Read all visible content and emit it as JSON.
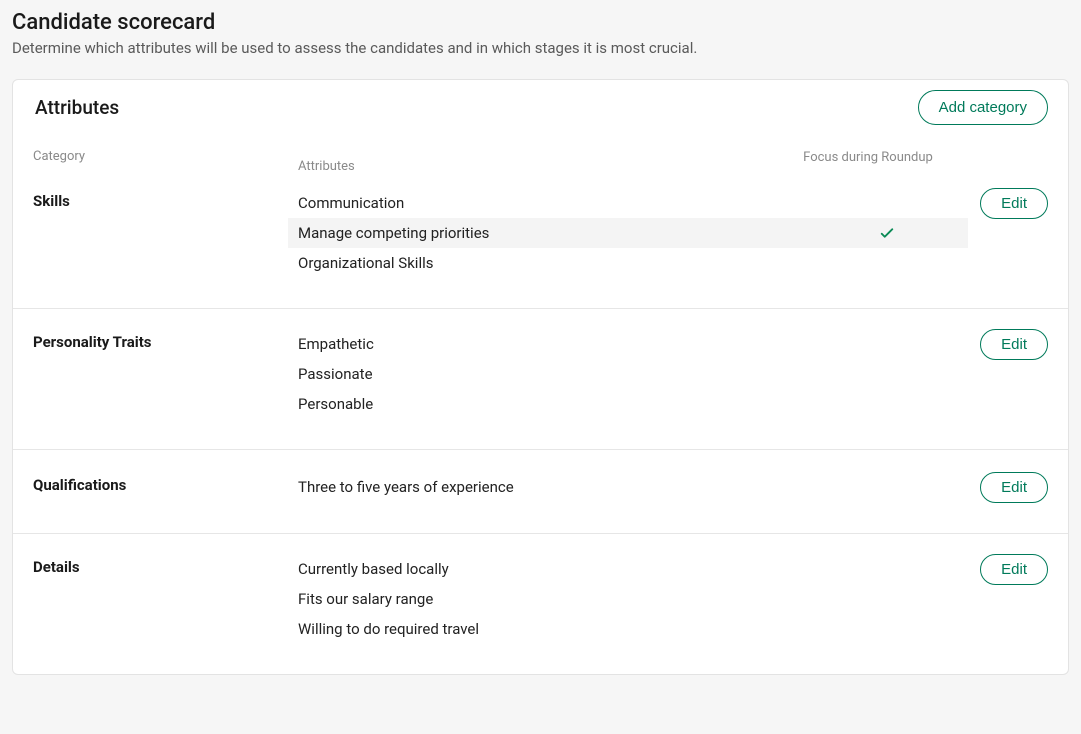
{
  "page": {
    "title": "Candidate scorecard",
    "subtitle": "Determine which attributes will be used to assess the candidates and in which stages it is most crucial."
  },
  "card": {
    "title": "Attributes",
    "addButton": "Add category",
    "editButton": "Edit",
    "headers": {
      "category": "Category",
      "attributes": "Attributes",
      "focus": "Focus during Roundup"
    }
  },
  "categories": [
    {
      "name": "Skills",
      "attributes": [
        {
          "label": "Communication",
          "focus": false,
          "highlight": false
        },
        {
          "label": "Manage competing priorities",
          "focus": true,
          "highlight": true
        },
        {
          "label": "Organizational Skills",
          "focus": false,
          "highlight": false
        }
      ]
    },
    {
      "name": "Personality Traits",
      "attributes": [
        {
          "label": "Empathetic",
          "focus": false,
          "highlight": false
        },
        {
          "label": "Passionate",
          "focus": false,
          "highlight": false
        },
        {
          "label": "Personable",
          "focus": false,
          "highlight": false
        }
      ]
    },
    {
      "name": "Qualifications",
      "attributes": [
        {
          "label": "Three to five years of experience",
          "focus": false,
          "highlight": false
        }
      ]
    },
    {
      "name": "Details",
      "attributes": [
        {
          "label": "Currently based locally",
          "focus": false,
          "highlight": false
        },
        {
          "label": "Fits our salary range",
          "focus": false,
          "highlight": false
        },
        {
          "label": "Willing to do required travel",
          "focus": false,
          "highlight": false
        }
      ]
    }
  ]
}
